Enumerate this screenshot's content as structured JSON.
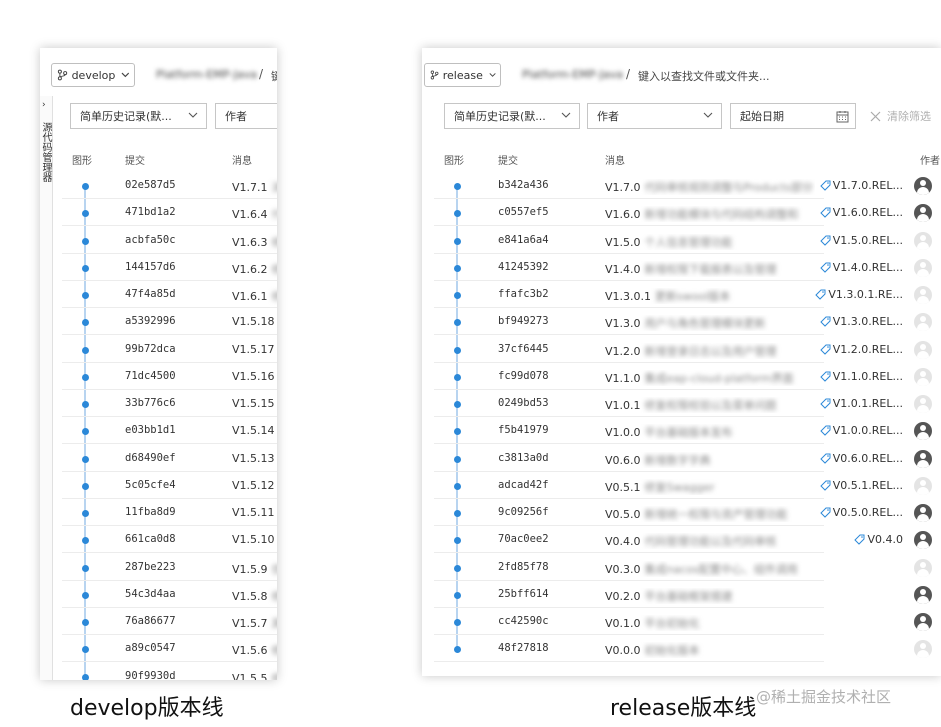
{
  "develop_panel": {
    "branch": "develop",
    "breadcrumb_blurred": "Platform-EMP-Java",
    "breadcrumb_sep": "/",
    "breadcrumb_tail": "键",
    "side_label": "源代码管理器",
    "filters": {
      "history": "简单历史记录(默...",
      "author": "作者"
    },
    "columns": {
      "graph": "图形",
      "commit": "提交",
      "message": "消息"
    },
    "rows": [
      {
        "hash": "02e587d5",
        "ver": "V1.7.1",
        "blur": "消"
      },
      {
        "hash": "471bd1a2",
        "ver": "V1.6.4",
        "blur": "什"
      },
      {
        "hash": "acbfa50c",
        "ver": "V1.6.3",
        "blur": "修"
      },
      {
        "hash": "144157d6",
        "ver": "V1.6.2",
        "blur": "修"
      },
      {
        "hash": "47f4a85d",
        "ver": "V1.6.1",
        "blur": "修"
      },
      {
        "hash": "a5392996",
        "ver": "V1.5.18",
        "blur": ""
      },
      {
        "hash": "99b72dca",
        "ver": "V1.5.17",
        "blur": ""
      },
      {
        "hash": "71dc4500",
        "ver": "V1.5.16",
        "blur": ""
      },
      {
        "hash": "33b776c6",
        "ver": "V1.5.15",
        "blur": ""
      },
      {
        "hash": "e03bb1d1",
        "ver": "V1.5.14",
        "blur": ""
      },
      {
        "hash": "d68490ef",
        "ver": "V1.5.13",
        "blur": ""
      },
      {
        "hash": "5c05cfe4",
        "ver": "V1.5.12",
        "blur": ""
      },
      {
        "hash": "11fba8d9",
        "ver": "V1.5.11",
        "blur": ""
      },
      {
        "hash": "661ca0d8",
        "ver": "V1.5.10",
        "blur": ""
      },
      {
        "hash": "287be223",
        "ver": "V1.5.9",
        "blur": "优"
      },
      {
        "hash": "54c3d4aa",
        "ver": "V1.5.8",
        "blur": "修"
      },
      {
        "hash": "76a86677",
        "ver": "V1.5.7",
        "blur": "其"
      },
      {
        "hash": "a89c0547",
        "ver": "V1.5.6",
        "blur": "修"
      },
      {
        "hash": "90f9930d",
        "ver": "V1.5.5",
        "blur": "修"
      }
    ]
  },
  "release_panel": {
    "branch": "release",
    "breadcrumb_blurred": "Platform-EMP-Java",
    "breadcrumb_sep": "/",
    "breadcrumb_text": "键入以查找文件或文件夹...",
    "filters": {
      "history": "简单历史记录(默...",
      "author": "作者",
      "start_date": "起始日期",
      "clear": "清除筛选"
    },
    "columns": {
      "graph": "图形",
      "commit": "提交",
      "message": "消息",
      "author": "作者"
    },
    "rows": [
      {
        "hash": "b342a436",
        "ver": "V1.7.0",
        "blur": "代码审核规则调整与Products部分",
        "tag": "V1.7.0.REL...",
        "avatar": "dark"
      },
      {
        "hash": "c0557ef5",
        "ver": "V1.6.0",
        "blur": "新增功能模块与代码结构调整和",
        "tag": "V1.6.0.REL...",
        "avatar": "dark"
      },
      {
        "hash": "e841a6a4",
        "ver": "V1.5.0",
        "blur": "个人信息管理功能",
        "tag": "V1.5.0.REL...",
        "avatar": "light"
      },
      {
        "hash": "41245392",
        "ver": "V1.4.0",
        "blur": "新增权限下载报表以及管理",
        "tag": "V1.4.0.REL...",
        "avatar": "light"
      },
      {
        "hash": "ffafc3b2",
        "ver": "V1.3.0.1",
        "blur": "更新swool版本",
        "tag": "V1.3.0.1.RE...",
        "avatar": "light"
      },
      {
        "hash": "bf949273",
        "ver": "V1.3.0",
        "blur": "用户与角色管理模块更新",
        "tag": "V1.3.0.REL...",
        "avatar": "light"
      },
      {
        "hash": "37cf6445",
        "ver": "V1.2.0",
        "blur": "新增登录日志以及用户管理",
        "tag": "V1.2.0.REL...",
        "avatar": "light"
      },
      {
        "hash": "fc99d078",
        "ver": "V1.1.0",
        "blur": "集成eap-cloud-platform界面",
        "tag": "V1.1.0.REL...",
        "avatar": "light"
      },
      {
        "hash": "0249bd53",
        "ver": "V1.0.1",
        "blur": "修复权限校验以及菜单问题",
        "tag": "V1.0.1.REL...",
        "avatar": "light"
      },
      {
        "hash": "f5b41979",
        "ver": "V1.0.0",
        "blur": "平台基础版本发布",
        "tag": "V1.0.0.REL...",
        "avatar": "dark"
      },
      {
        "hash": "c3813a0d",
        "ver": "V0.6.0",
        "blur": "新增数字字典",
        "tag": "V0.6.0.REL...",
        "avatar": "dark"
      },
      {
        "hash": "adcad42f",
        "ver": "V0.5.1",
        "blur": "修复Swagger",
        "tag": "V0.5.1.REL...",
        "avatar": "light"
      },
      {
        "hash": "9c09256f",
        "ver": "V0.5.0",
        "blur": "新增统一权限与资产管理功能",
        "tag": "V0.5.0.REL...",
        "avatar": "dark"
      },
      {
        "hash": "70ac0ee2",
        "ver": "V0.4.0",
        "blur": "代码管理功能以及代码审核",
        "tag": "V0.4.0",
        "avatar": "dark"
      },
      {
        "hash": "2fd85f78",
        "ver": "V0.3.0",
        "blur": "集成nacos配置中心、组件调用",
        "tag": "",
        "avatar": "light"
      },
      {
        "hash": "25bff614",
        "ver": "V0.2.0",
        "blur": "平台基础框架搭建",
        "tag": "",
        "avatar": "dark"
      },
      {
        "hash": "cc42590c",
        "ver": "V0.1.0",
        "blur": "平台初始化",
        "tag": "",
        "avatar": "dark"
      },
      {
        "hash": "48f27818",
        "ver": "V0.0.0",
        "blur": "初始化版本",
        "tag": "",
        "avatar": "light"
      }
    ]
  },
  "captions": {
    "left": "develop版本线",
    "right": "release版本线"
  },
  "watermark": "@稀土掘金技术社区",
  "colors": {
    "graph_dot": "#2b88d8",
    "graph_line": "#b8d4f0"
  }
}
